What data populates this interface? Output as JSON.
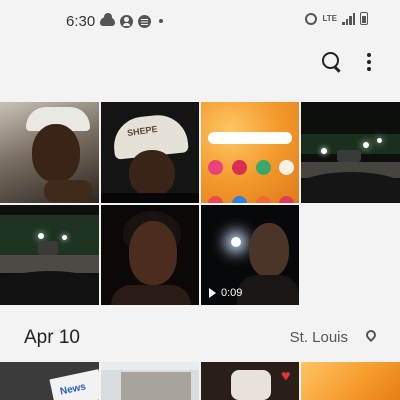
{
  "status_bar": {
    "time": "6:30",
    "network": "LTE",
    "icons_left": [
      "cloud-icon",
      "account-icon",
      "spotify-icon",
      "dot-icon"
    ],
    "icons_right": [
      "alarm-icon",
      "signal-icon",
      "battery-icon"
    ]
  },
  "toolbar": {
    "icons": [
      "search-icon",
      "more-options-icon"
    ]
  },
  "gallery": {
    "row1_row2_thumbs": [
      {
        "type": "photo",
        "desc": "selfie-car"
      },
      {
        "type": "photo",
        "desc": "selfie-cap"
      },
      {
        "type": "screenshot",
        "desc": "home-screen"
      },
      {
        "type": "photo",
        "desc": "night-road"
      },
      {
        "type": "photo",
        "desc": "night-road-2"
      },
      {
        "type": "photo",
        "desc": "selfie-dark"
      },
      {
        "type": "video",
        "duration": "0:09"
      }
    ],
    "group": {
      "date": "Apr 10",
      "location": "St. Louis",
      "location_icon": "location-pin-icon"
    },
    "row3_thumbs": [
      "photo",
      "photo",
      "photo",
      "screenshot"
    ]
  }
}
